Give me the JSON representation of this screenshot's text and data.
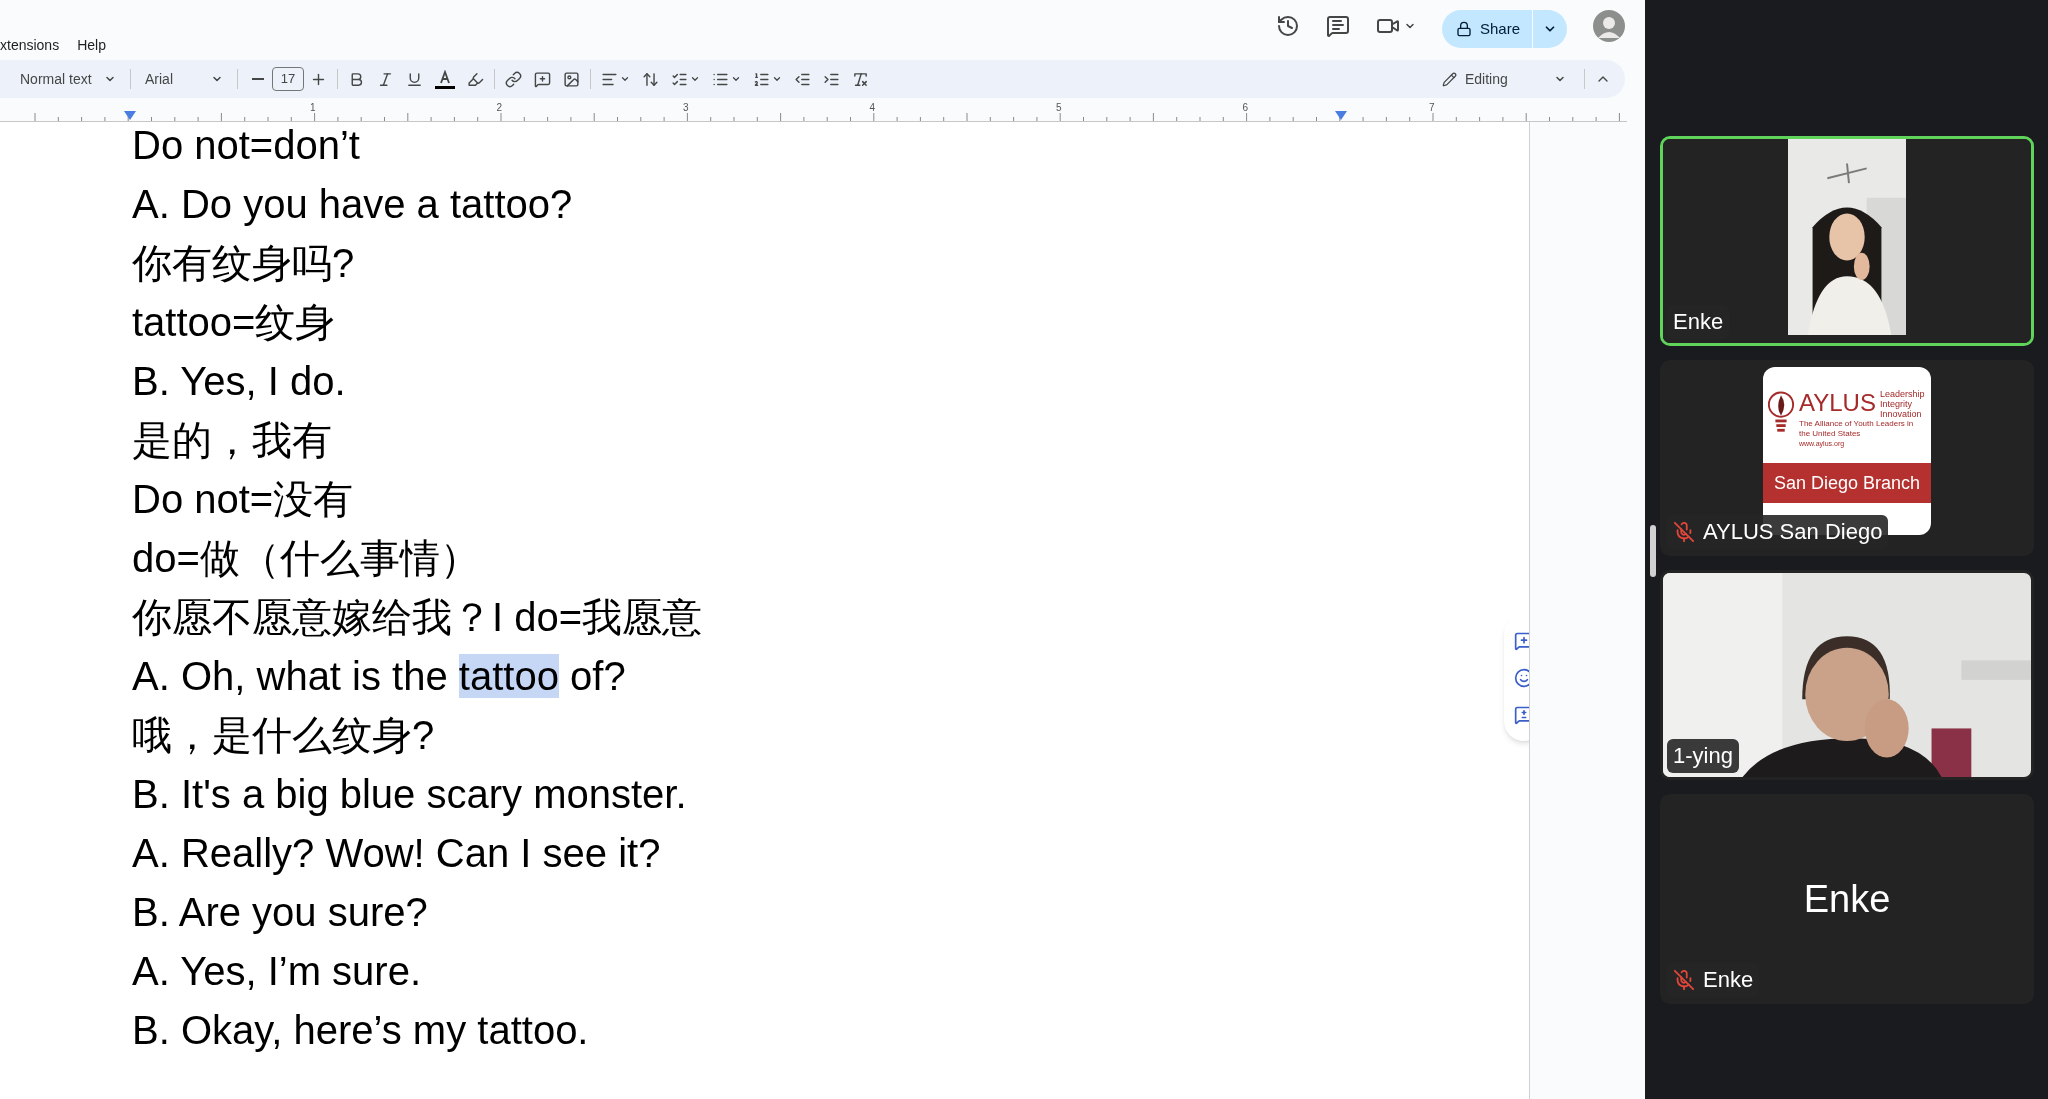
{
  "menu": [
    "xtensions",
    "Help"
  ],
  "share": {
    "label": "Share"
  },
  "toolbar": {
    "style": "Normal text",
    "font": "Arial",
    "font_size": "17",
    "mode": "Editing"
  },
  "ruler": [
    "1",
    "2",
    "3",
    "4",
    "5",
    "6",
    "7"
  ],
  "document": {
    "lines": [
      {
        "segments": [
          {
            "text": "Do not=don’t",
            "selected": false
          }
        ]
      },
      {
        "segments": [
          {
            "text": "A. Do you have a tattoo?",
            "selected": false
          }
        ]
      },
      {
        "segments": [
          {
            "text": "你有纹身吗?",
            "selected": false
          }
        ]
      },
      {
        "segments": [
          {
            "text": "tattoo=纹身",
            "selected": false
          }
        ]
      },
      {
        "segments": [
          {
            "text": "B. Yes, I do.",
            "selected": false
          }
        ]
      },
      {
        "segments": [
          {
            "text": "是的，我有",
            "selected": false
          }
        ]
      },
      {
        "segments": [
          {
            "text": "Do not=没有",
            "selected": false
          }
        ]
      },
      {
        "segments": [
          {
            "text": "do=做（什么事情）",
            "selected": false
          }
        ]
      },
      {
        "segments": [
          {
            "text": "你愿不愿意嫁给我？I do=我愿意",
            "selected": false
          }
        ]
      },
      {
        "segments": [
          {
            "text": "A. Oh, what is the ",
            "selected": false
          },
          {
            "text": "tattoo",
            "selected": true
          },
          {
            "text": " of?",
            "selected": false
          }
        ]
      },
      {
        "segments": [
          {
            "text": "哦，是什么纹身?",
            "selected": false
          }
        ]
      },
      {
        "segments": [
          {
            "text": "B. It's a big blue scary monster.",
            "selected": false
          }
        ]
      },
      {
        "segments": [
          {
            "text": "A. Really? Wow! Can I see it?",
            "selected": false
          }
        ]
      },
      {
        "segments": [
          {
            "text": "B. Are you sure?",
            "selected": false
          }
        ]
      },
      {
        "segments": [
          {
            "text": "A. Yes, I’m sure.",
            "selected": false
          }
        ]
      },
      {
        "segments": [
          {
            "text": "B. Okay, here’s my tattoo.",
            "selected": false
          }
        ]
      }
    ]
  },
  "participants": [
    {
      "name": "Enke",
      "kind": "video",
      "active": true,
      "muted": false
    },
    {
      "name": "AYLUS San Diego",
      "kind": "logo",
      "active": false,
      "muted": true,
      "logo": {
        "title": "AYLUS",
        "motto": [
          "Leadership",
          "Integrity",
          "Innovation"
        ],
        "subtitle": "The Alliance of Youth Leaders in the United States",
        "url": "www.aylus.org",
        "branch": "San Diego Branch"
      }
    },
    {
      "name": "1-ying",
      "kind": "video",
      "active": false,
      "muted": false
    },
    {
      "name": "Enke",
      "kind": "avatar",
      "active": false,
      "muted": true,
      "display": "Enke"
    }
  ]
}
